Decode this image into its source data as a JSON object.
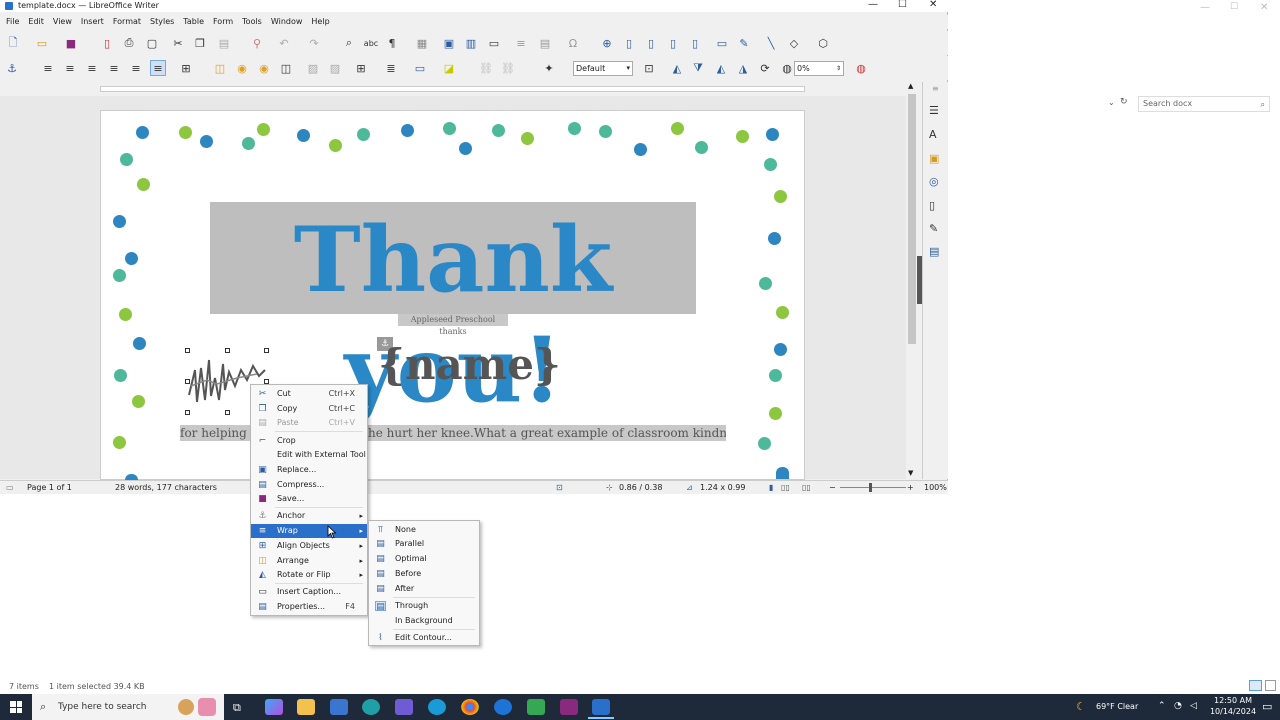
{
  "window": {
    "title": "template.docx — LibreOffice Writer"
  },
  "menus": [
    "File",
    "Edit",
    "View",
    "Insert",
    "Format",
    "Styles",
    "Table",
    "Form",
    "Tools",
    "Window",
    "Help"
  ],
  "toolbar2": {
    "style_select": "Default",
    "percent": "0%"
  },
  "document": {
    "heading": "Thank you!",
    "subtitle": "Appleseed Preschool thanks",
    "name": "{name}",
    "body_left": "for helping",
    "body_right": "he hurt her knee.What a great example of classroom kindness!"
  },
  "status": {
    "page": "Page 1 of 1",
    "words": "28 words, 177 characters",
    "position": "0.86 / 0.38",
    "size": "1.24 x 0.99",
    "zoom": "100%"
  },
  "context_menu": [
    {
      "label": "Cut",
      "shortcut": "Ctrl+X",
      "icon": "scissors-icon"
    },
    {
      "label": "Copy",
      "shortcut": "Ctrl+C",
      "icon": "copy-icon"
    },
    {
      "label": "Paste",
      "shortcut": "Ctrl+V",
      "icon": "paste-icon",
      "disabled": true
    },
    {
      "label": "Crop",
      "icon": "crop-icon"
    },
    {
      "label": "Edit with External Tool"
    },
    {
      "label": "Replace...",
      "icon": "image-icon"
    },
    {
      "label": "Compress...",
      "icon": "compress-icon"
    },
    {
      "label": "Save...",
      "icon": "save-icon"
    },
    {
      "label": "Anchor",
      "icon": "anchor-icon",
      "submenu": true
    },
    {
      "label": "Wrap",
      "icon": "wrap-icon",
      "submenu": true,
      "highlighted": true
    },
    {
      "label": "Align Objects",
      "icon": "align-icon",
      "submenu": true
    },
    {
      "label": "Arrange",
      "icon": "arrange-icon",
      "submenu": true
    },
    {
      "label": "Rotate or Flip",
      "icon": "rotate-icon",
      "submenu": true
    },
    {
      "label": "Insert Caption...",
      "icon": "caption-icon"
    },
    {
      "label": "Properties...",
      "shortcut": "F4",
      "icon": "properties-icon"
    }
  ],
  "wrap_submenu": [
    "None",
    "Parallel",
    "Optimal",
    "Before",
    "After",
    "Through",
    "In Background",
    "Edit Contour..."
  ],
  "explorer": {
    "search_placeholder": "Search docx",
    "status_items": "7 items",
    "status_selected": "1 item selected  39.4 KB"
  },
  "taskbar": {
    "search_placeholder": "Type here to search",
    "weather": "69°F  Clear",
    "time": "12:50 AM",
    "date": "10/14/2024"
  },
  "colors": {
    "accent": "#2b88c6",
    "dot_blue": "#2e86c1",
    "dot_green": "#8dc63f",
    "dot_teal": "#4db89a",
    "menu_highlight": "#2a6fc9"
  }
}
